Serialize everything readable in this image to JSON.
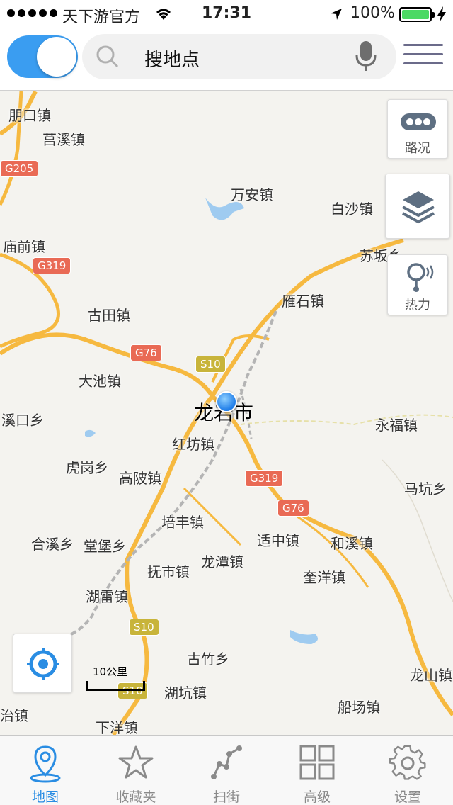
{
  "status_bar": {
    "carrier": "天下游官方",
    "time": "17:31",
    "battery_pct": "100%"
  },
  "search": {
    "placeholder": "搜地点"
  },
  "map_buttons": {
    "traffic": "路况",
    "heat": "热力"
  },
  "places": {
    "p1": "朋口镇",
    "p2": "莒溪镇",
    "p3": "万安镇",
    "p4": "白沙镇",
    "p5": "庙前镇",
    "p6": "苏坂乡",
    "p7": "雁石镇",
    "p8": "古田镇",
    "p9": "大池镇",
    "p10": "龙岩市",
    "p11": "溪口乡",
    "p12": "永福镇",
    "p13": "红坊镇",
    "p14": "虎岗乡",
    "p15": "高陂镇",
    "p16": "马坑乡",
    "p17": "培丰镇",
    "p18": "合溪乡",
    "p19": "堂堡乡",
    "p20": "适中镇",
    "p21": "和溪镇",
    "p22": "抚市镇",
    "p23": "龙潭镇",
    "p24": "奎洋镇",
    "p25": "湖雷镇",
    "p26": "古竹乡",
    "p27": "龙山镇",
    "p28": "湖坑镇",
    "p29": "治镇",
    "p30": "下洋镇",
    "p31": "船场镇"
  },
  "shields": {
    "g205": "G205",
    "g319a": "G319",
    "g76a": "G76",
    "s10a": "S10",
    "g319b": "G319",
    "g76b": "G76",
    "s10b": "S10",
    "s10c": "S10"
  },
  "scale": {
    "label": "10公里"
  },
  "tabs": [
    {
      "label": "地图",
      "icon": "map-pin-icon",
      "active": true
    },
    {
      "label": "收藏夹",
      "icon": "star-icon",
      "active": false
    },
    {
      "label": "扫街",
      "icon": "route-icon",
      "active": false
    },
    {
      "label": "高级",
      "icon": "grid-icon",
      "active": false
    },
    {
      "label": "设置",
      "icon": "gear-icon",
      "active": false
    }
  ],
  "colors": {
    "accent": "#2a8de3",
    "toggle": "#3a9df1",
    "highway": "#f6b940",
    "shield_red": "#e96a55",
    "shield_yellow": "#c8b43a"
  }
}
